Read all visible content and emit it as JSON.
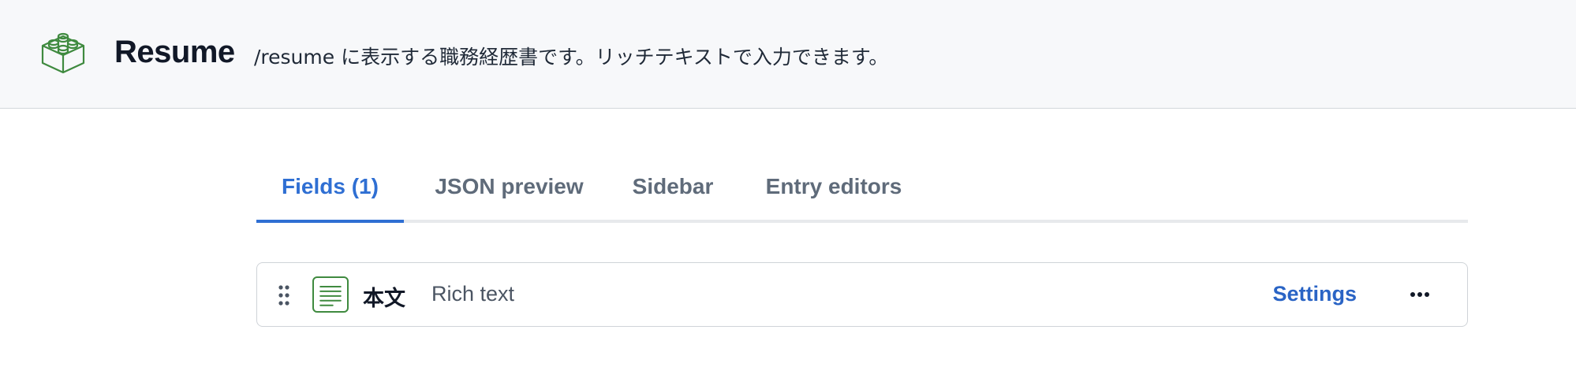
{
  "header": {
    "logo_icon": "content-type-block-icon",
    "title": "Resume",
    "description": "/resume に表示する職務経歴書です。リッチテキストで入力できます。"
  },
  "tabs": [
    {
      "label": "Fields (1)",
      "active": true
    },
    {
      "label": "JSON preview",
      "active": false
    },
    {
      "label": "Sidebar",
      "active": false
    },
    {
      "label": "Entry editors",
      "active": false
    }
  ],
  "fields": [
    {
      "drag_icon": "drag-handle-icon",
      "type_icon": "rich-text-icon",
      "name": "本文",
      "type": "Rich text",
      "settings_label": "Settings",
      "more_icon": "more-horizontal-icon"
    }
  ],
  "colors": {
    "accent": "#2f6fd3",
    "icon_green": "#3f8a3f",
    "header_bg": "#f7f8fa"
  }
}
